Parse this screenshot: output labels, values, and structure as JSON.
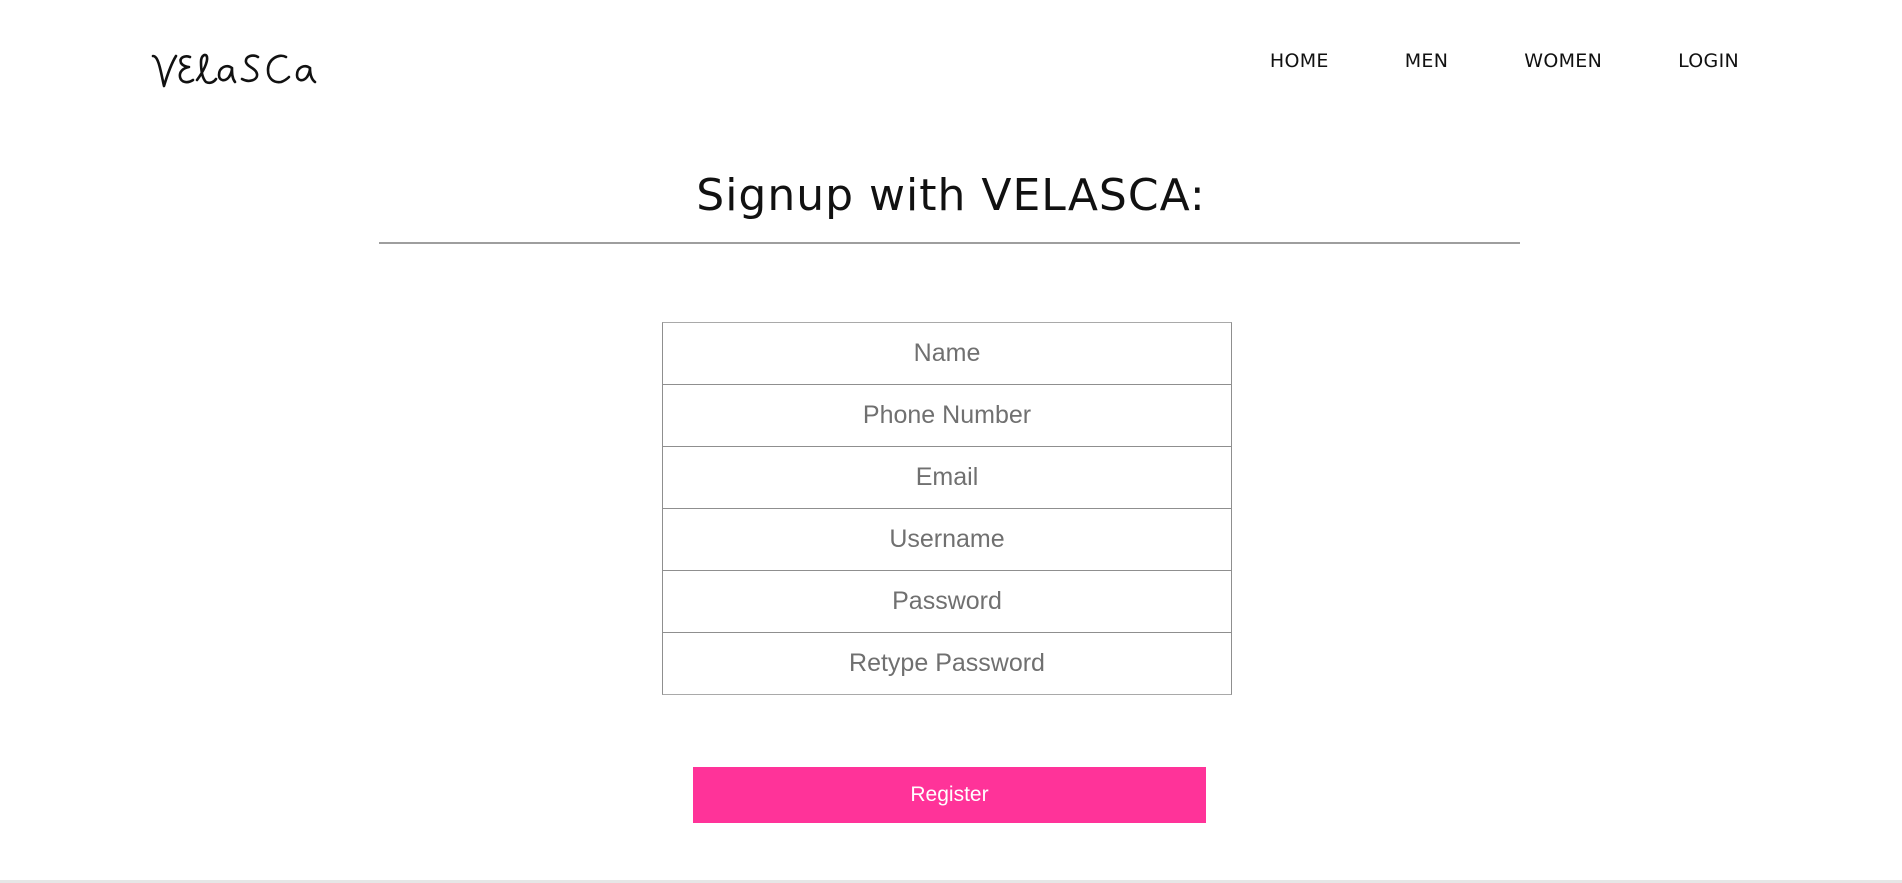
{
  "brand": {
    "logo_text": "VELASCA"
  },
  "nav": {
    "items": [
      {
        "label": "HOME"
      },
      {
        "label": "MEN"
      },
      {
        "label": "WOMEN"
      },
      {
        "label": "LOGIN"
      }
    ]
  },
  "signup": {
    "title": "Signup with VELASCA:",
    "fields": {
      "name": {
        "placeholder": "Name",
        "value": ""
      },
      "phone": {
        "placeholder": "Phone Number",
        "value": ""
      },
      "email": {
        "placeholder": "Email",
        "value": ""
      },
      "username": {
        "placeholder": "Username",
        "value": ""
      },
      "password": {
        "placeholder": "Password",
        "value": ""
      },
      "retype_password": {
        "placeholder": "Retype Password",
        "value": ""
      }
    },
    "register_label": "Register"
  },
  "colors": {
    "accent": "#ff3399",
    "text": "#111111",
    "placeholder": "#707070",
    "border": "#8f8f8f",
    "rule": "#9e9e9e"
  }
}
